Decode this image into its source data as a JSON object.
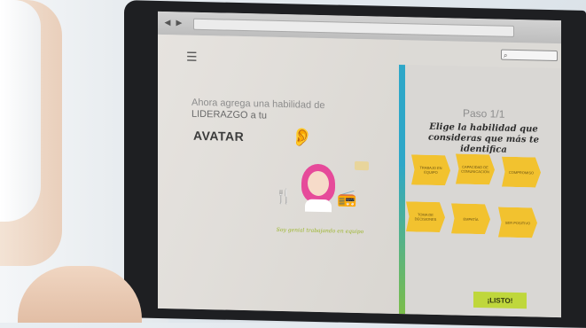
{
  "app": {
    "intro_line1": "Ahora agrega una habilidad de",
    "intro_line2": "LIDERAZGO a tu",
    "avatar_word": "AVATAR",
    "avatar_caption": "Soy genial trabajando en equipo",
    "step_label": "Paso 1/1",
    "instruction": "Elige la habilidad que consideras que más te identifica",
    "skills": [
      "TRABAJO EN EQUIPO",
      "CAPACIDAD DE COMUNICACIÓN",
      "COMPROMISO",
      "TOMA DE DECISIONES",
      "EMPATÍA",
      "SER POSITIVO"
    ],
    "confirm_label": "¡LISTO!",
    "search_placeholder": ""
  },
  "icons": {
    "menu": "hamburger-menu-icon",
    "search": "search-icon",
    "ear": "ear-icon",
    "chef": "chef-hat-icon",
    "avatar": "girl-avatar-icon",
    "radio": "radio-icon"
  },
  "colors": {
    "skill_tag": "#f2c22f",
    "confirm_button": "#bfd73c",
    "divider_top": "#2ea7c8",
    "divider_bottom": "#7bbd4a",
    "avatar_hair": "#e64a9a"
  }
}
